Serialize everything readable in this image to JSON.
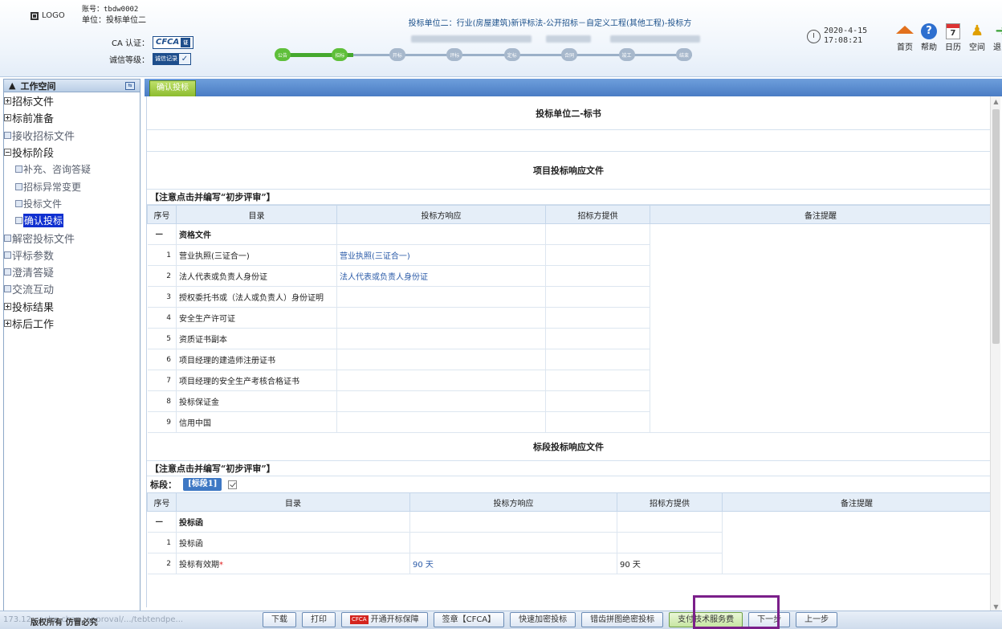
{
  "header": {
    "logo_text": "LOGO",
    "account_line": "账号：tbdw0002",
    "unit_line": "单位：投标单位二",
    "ca_label": "CA 认证：",
    "cfca_text": "CFCA",
    "credit_label": "诚信等级：",
    "credit_badge": "诚信记录",
    "project_title": "投标单位二：行业(房屋建筑)新评标法-公开招标－自定义工程(其他工程)-投标方",
    "date": "2020-4-15",
    "time": "17:08:21",
    "progress_nodes": [
      "公告",
      "招标",
      "开标",
      "评标",
      "定标",
      "合同",
      "竣工",
      "结束"
    ],
    "progress_done_count": 2,
    "nav": [
      {
        "label": "首页",
        "icon": "home-icon"
      },
      {
        "label": "帮助",
        "icon": "help-icon"
      },
      {
        "label": "日历",
        "icon": "calendar-icon"
      },
      {
        "label": "空间",
        "icon": "space-icon"
      },
      {
        "label": "退出",
        "icon": "exit-icon"
      }
    ]
  },
  "sidebar": {
    "title": "工作空间",
    "items": [
      {
        "label": "招标文件",
        "type": "plus",
        "level": 0,
        "grey": false
      },
      {
        "label": "标前准备",
        "type": "plus",
        "level": 0,
        "grey": false
      },
      {
        "label": "接收招标文件",
        "type": "dot",
        "level": 0,
        "grey": true
      },
      {
        "label": "投标阶段",
        "type": "minus",
        "level": 0,
        "grey": false
      },
      {
        "label": "补充、咨询答疑",
        "type": "dot",
        "level": 1,
        "grey": true
      },
      {
        "label": "招标异常变更",
        "type": "dot",
        "level": 1,
        "grey": true
      },
      {
        "label": "投标文件",
        "type": "dot",
        "level": 1,
        "grey": true
      },
      {
        "label": "确认投标",
        "type": "dot",
        "level": 1,
        "grey": false,
        "active": true
      },
      {
        "label": "解密投标文件",
        "type": "dot",
        "level": 0,
        "grey": true
      },
      {
        "label": "评标参数",
        "type": "dot",
        "level": 0,
        "grey": true
      },
      {
        "label": "澄清答疑",
        "type": "dot",
        "level": 0,
        "grey": true
      },
      {
        "label": "交流互动",
        "type": "dot",
        "level": 0,
        "grey": true
      },
      {
        "label": "投标结果",
        "type": "plus",
        "level": 0,
        "grey": false
      },
      {
        "label": "标后工作",
        "type": "plus",
        "level": 0,
        "grey": false
      }
    ]
  },
  "tab": {
    "label": "确认投标"
  },
  "main": {
    "doc_title": "投标单位二-标书",
    "project_section_title": "项目投标响应文件",
    "project_note": "【注意点击并编写“初步评审”】",
    "project_columns": [
      "序号",
      "目录",
      "投标方响应",
      "招标方提供",
      "备注提醒"
    ],
    "project_group": {
      "num": "一",
      "name": "资格文件"
    },
    "project_rows": [
      {
        "num": "1",
        "name": "营业执照(三证合一)",
        "response": "营业执照(三证合一)",
        "provide": ""
      },
      {
        "num": "2",
        "name": "法人代表或负责人身份证",
        "response": "法人代表或负责人身份证",
        "provide": ""
      },
      {
        "num": "3",
        "name": "授权委托书或（法人或负责人）身份证明",
        "response": "",
        "provide": ""
      },
      {
        "num": "4",
        "name": "安全生产许可证",
        "response": "",
        "provide": ""
      },
      {
        "num": "5",
        "name": "资质证书副本",
        "response": "",
        "provide": ""
      },
      {
        "num": "6",
        "name": "项目经理的建造师注册证书",
        "response": "",
        "provide": ""
      },
      {
        "num": "7",
        "name": "项目经理的安全生产考核合格证书",
        "response": "",
        "provide": ""
      },
      {
        "num": "8",
        "name": "投标保证金",
        "response": "",
        "provide": ""
      },
      {
        "num": "9",
        "name": "信用中国",
        "response": "",
        "provide": ""
      }
    ],
    "lot_section_title": "标段投标响应文件",
    "lot_note": "【注意点击并编写“初步评审”】",
    "lot_label": "标段：",
    "lot_tag": "[标段1]",
    "lot_columns": [
      "序号",
      "目录",
      "投标方响应",
      "招标方提供",
      "备注提醒"
    ],
    "lot_group": {
      "num": "一",
      "name": "投标函"
    },
    "lot_rows": [
      {
        "num": "1",
        "name": "投标函",
        "required": false,
        "response": "",
        "provide": ""
      },
      {
        "num": "2",
        "name": "投标有效期",
        "required": true,
        "response": "90 天",
        "provide": "90 天"
      }
    ]
  },
  "footer": {
    "copyright": "版权所有 仿冒必究",
    "ghost_text": "173.12...ache-char...approval/.../tebtendpe...",
    "buttons": [
      "下载",
      "打印",
      "开通开标保障",
      "签章【CFCA】",
      "快速加密投标",
      "错齿拼图绝密投标",
      "支付技术服务费",
      "下一步",
      "上一步"
    ]
  },
  "colors": {
    "accent": "#4a7cc4",
    "progress_done": "#5fbf3a",
    "highlight_frame": "#7b1f8a",
    "link": "#2b5ba8"
  }
}
